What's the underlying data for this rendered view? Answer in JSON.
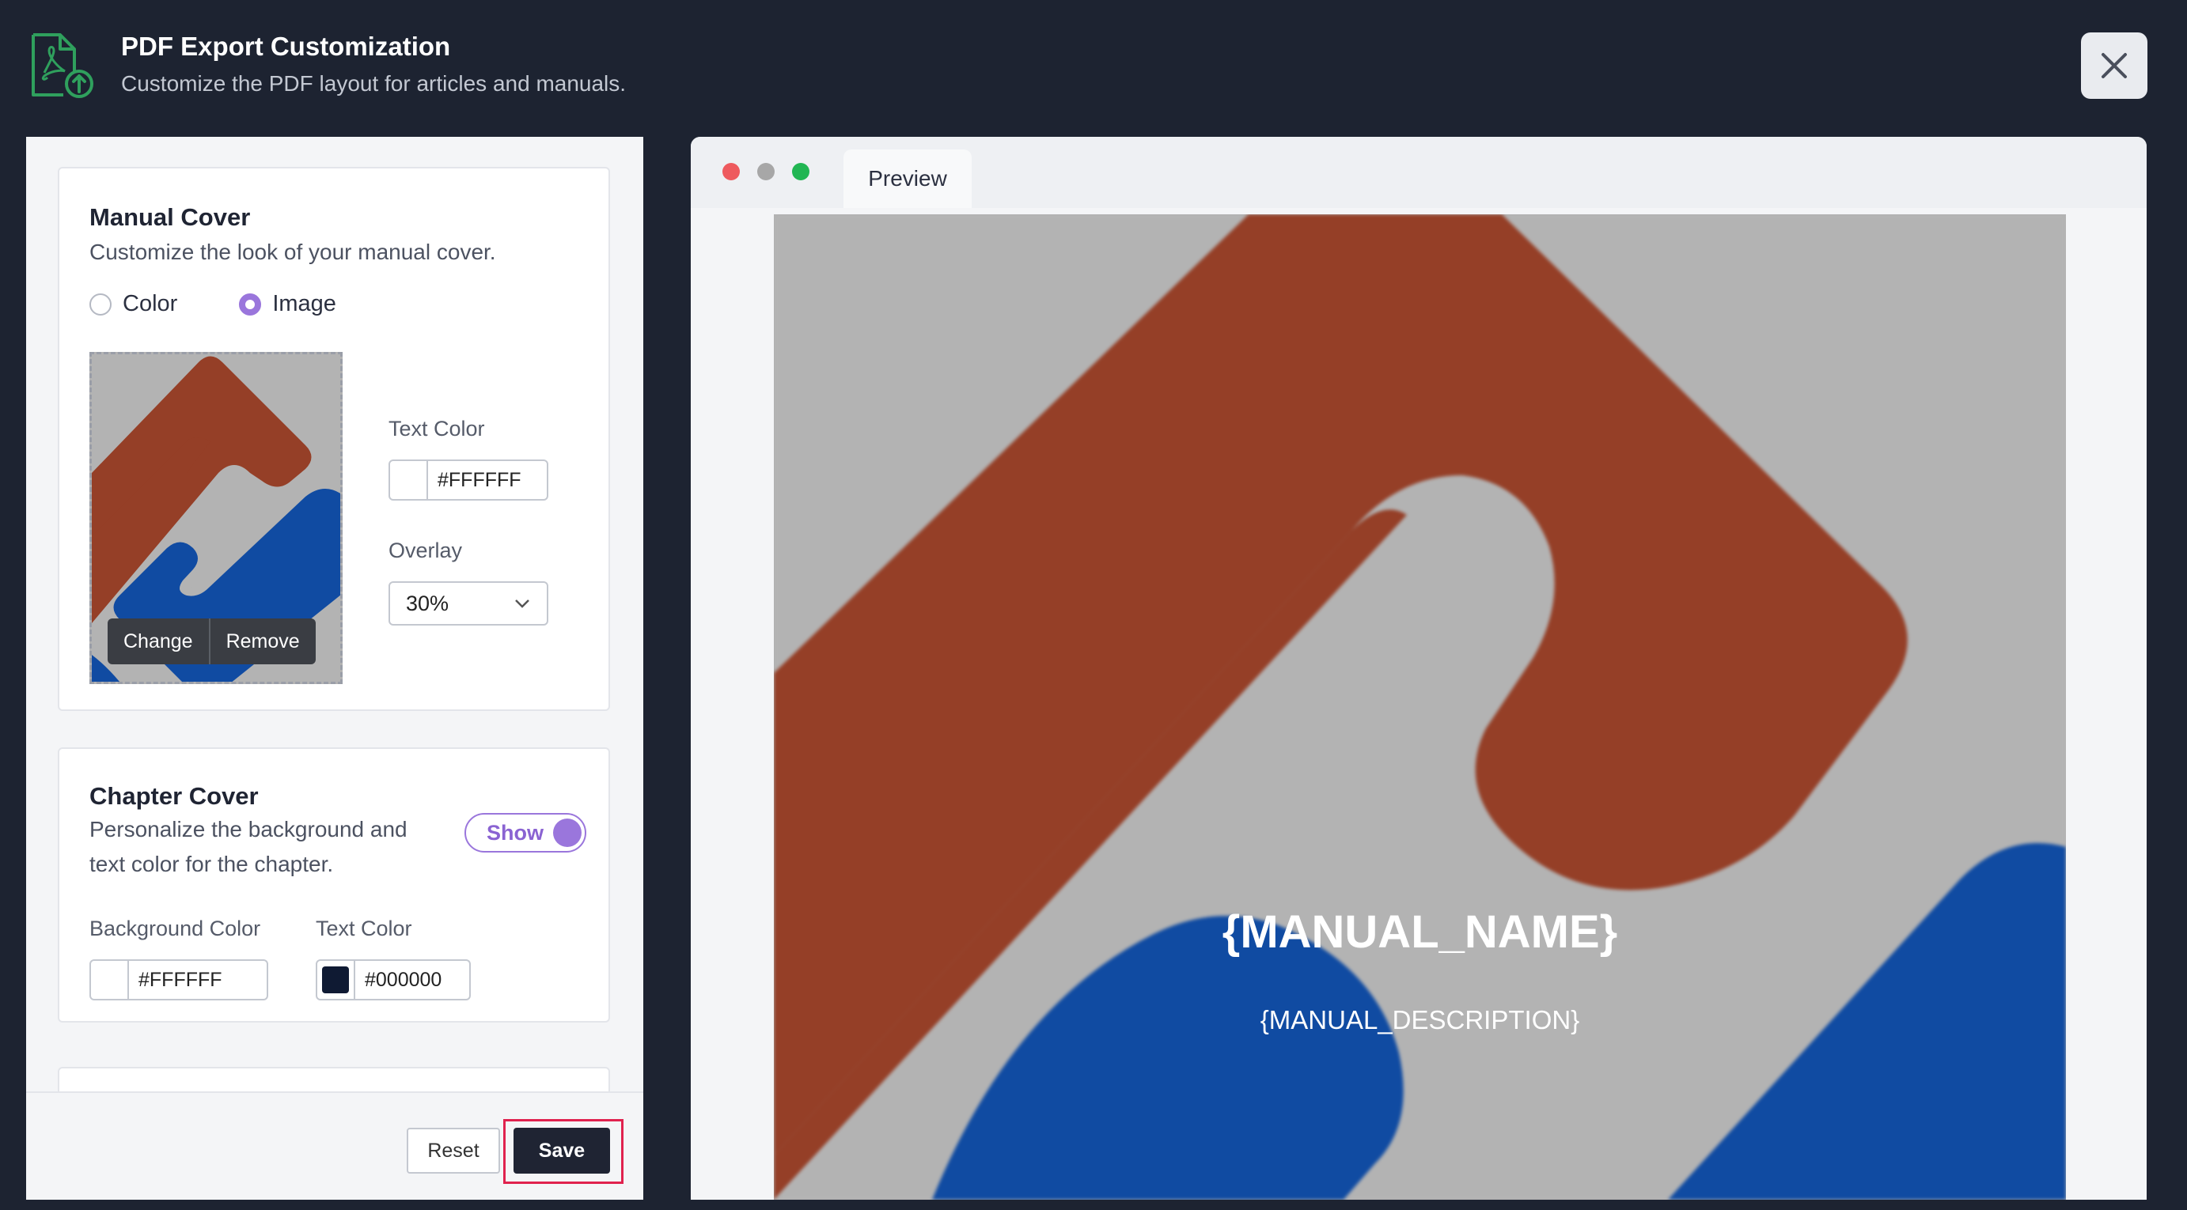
{
  "header": {
    "icon": "pdf-upload-icon",
    "title": "PDF Export Customization",
    "subtitle": "Customize the PDF layout for articles and manuals.",
    "close_icon": "close-icon"
  },
  "manual_cover": {
    "title": "Manual Cover",
    "description": "Customize the look of your manual cover.",
    "options": [
      "Color",
      "Image"
    ],
    "selected_option": "Image",
    "change_label": "Change",
    "remove_label": "Remove",
    "text_color_label": "Text Color",
    "text_color_value": "#FFFFFF",
    "overlay_label": "Overlay",
    "overlay_value": "30%"
  },
  "chapter_cover": {
    "title": "Chapter Cover",
    "description_line1": "Personalize the background and",
    "description_line2": "text color for the chapter.",
    "toggle_label": "Show",
    "toggle_on": true,
    "bg_color_label": "Background Color",
    "bg_color_value": "#FFFFFF",
    "text_color_label": "Text Color",
    "text_color_value": "#000000"
  },
  "footer": {
    "reset_label": "Reset",
    "save_label": "Save"
  },
  "preview": {
    "tab_label": "Preview",
    "manual_name": "{MANUAL_NAME}",
    "manual_description": "{MANUAL_DESCRIPTION}"
  },
  "colors": {
    "accent": "#9a76dc",
    "icon_green": "#2fa05d",
    "cover_red": "#953f27",
    "cover_blue": "#104ba2",
    "cover_gray": "#b3b3b3"
  }
}
